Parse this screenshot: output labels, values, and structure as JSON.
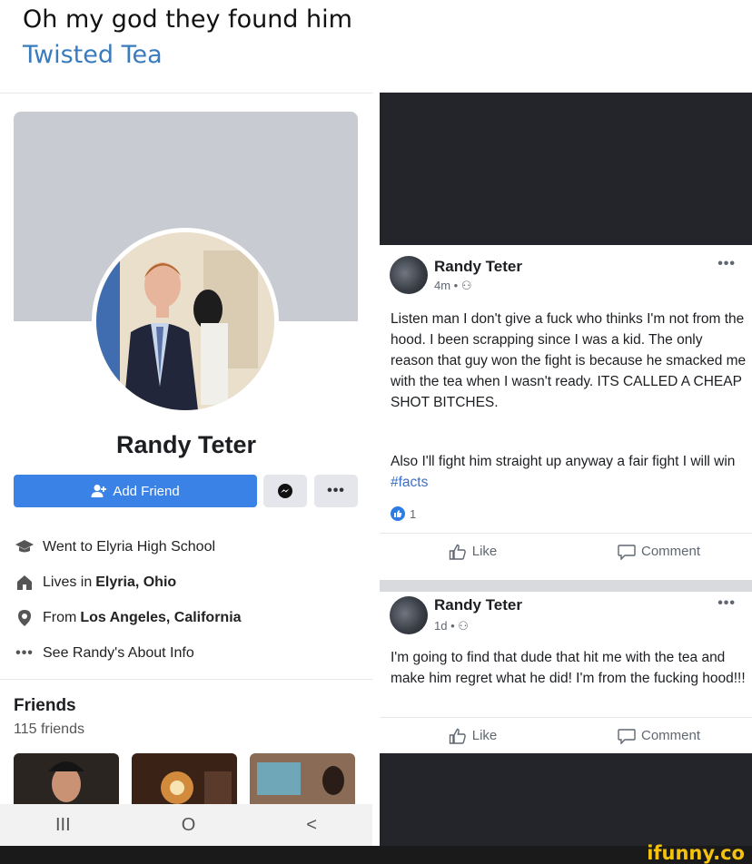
{
  "caption": {
    "title": "Oh my god they found him",
    "subtitle": "Twisted Tea"
  },
  "profile": {
    "name": "Randy Teter",
    "add_friend_label": "Add Friend",
    "more_label": "•••",
    "info": {
      "school": "Went to Elyria High School",
      "lives_prefix": "Lives in",
      "lives_city": "Elyria, Ohio",
      "from_prefix": "From",
      "from_city": "Los Angeles, California",
      "about": "See Randy's About Info"
    },
    "friends_title": "Friends",
    "friends_count": "115 friends"
  },
  "nav": {
    "recent": "III",
    "home": "O",
    "back": "<"
  },
  "posts": [
    {
      "author": "Randy Teter",
      "meta": "4m •",
      "text_1": "Listen man I don't give a fuck who thinks I'm not from the hood. I been scrapping since I was a kid. The only reason that guy won the fight is because he smacked me with the tea when I wasn't ready. ITS CALLED A CHEAP SHOT BITCHES.",
      "text_2": "Also I'll fight him straight up anyway a fair fight I will win",
      "hashtag": "#facts",
      "reaction_count": "1",
      "like_label": "Like",
      "comment_label": "Comment"
    },
    {
      "author": "Randy Teter",
      "meta": "1d •",
      "text_1": "I'm going to find that dude that hit me with the tea and make him regret what he did! I'm from the fucking hood!!!",
      "like_label": "Like",
      "comment_label": "Comment"
    }
  ],
  "watermark": "ifunny.co",
  "colors": {
    "facebook_blue": "#3b82e6",
    "caption_link": "#3a7bbd",
    "watermark": "#f4c20d"
  }
}
